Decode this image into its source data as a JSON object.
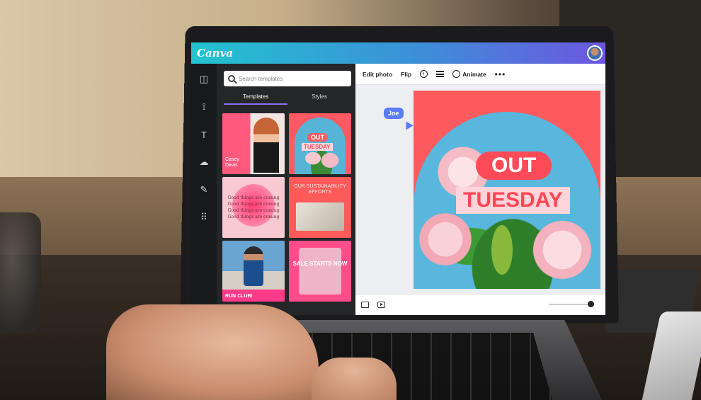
{
  "app": {
    "name": "Canva"
  },
  "rail": {
    "items": [
      {
        "name": "design",
        "icon": "layout-icon",
        "glyph": "◫"
      },
      {
        "name": "elements",
        "icon": "shapes-icon",
        "glyph": "⟟"
      },
      {
        "name": "text",
        "icon": "text-icon",
        "glyph": "T"
      },
      {
        "name": "uploads",
        "icon": "upload-cloud-icon",
        "glyph": "☁"
      },
      {
        "name": "draw",
        "icon": "draw-icon",
        "glyph": "✎"
      },
      {
        "name": "apps",
        "icon": "apps-grid-icon",
        "glyph": "⠿"
      }
    ]
  },
  "panel": {
    "search_placeholder": "Search templates",
    "tabs": [
      {
        "label": "Templates",
        "active": true
      },
      {
        "label": "Styles",
        "active": false
      }
    ],
    "templates": {
      "t1": "Casey Davis",
      "t2_line1": "OUT",
      "t2_line2": "TUESDAY",
      "t3": "Good things are coming Good things are coming Good things are coming Good things are coming",
      "t4": "OUR SUSTAINABILITY EFFORTS",
      "t5": "RUN CLUB!",
      "t6": "SALE STARTS NOW"
    }
  },
  "toolbar": {
    "edit_photo": "Edit photo",
    "flip": "Flip",
    "info_glyph": "i",
    "animate": "Animate",
    "more_glyph": "•••"
  },
  "canvas": {
    "collaborator": "Joe",
    "headline_1": "OUT",
    "headline_2": "TUESDAY"
  },
  "colors": {
    "brand_gradient_start": "#22c3cf",
    "brand_gradient_end": "#6d56e0",
    "design_red": "#ff5a5e",
    "design_blue": "#59b6dc",
    "collaborator_blue": "#5b7cf7"
  }
}
